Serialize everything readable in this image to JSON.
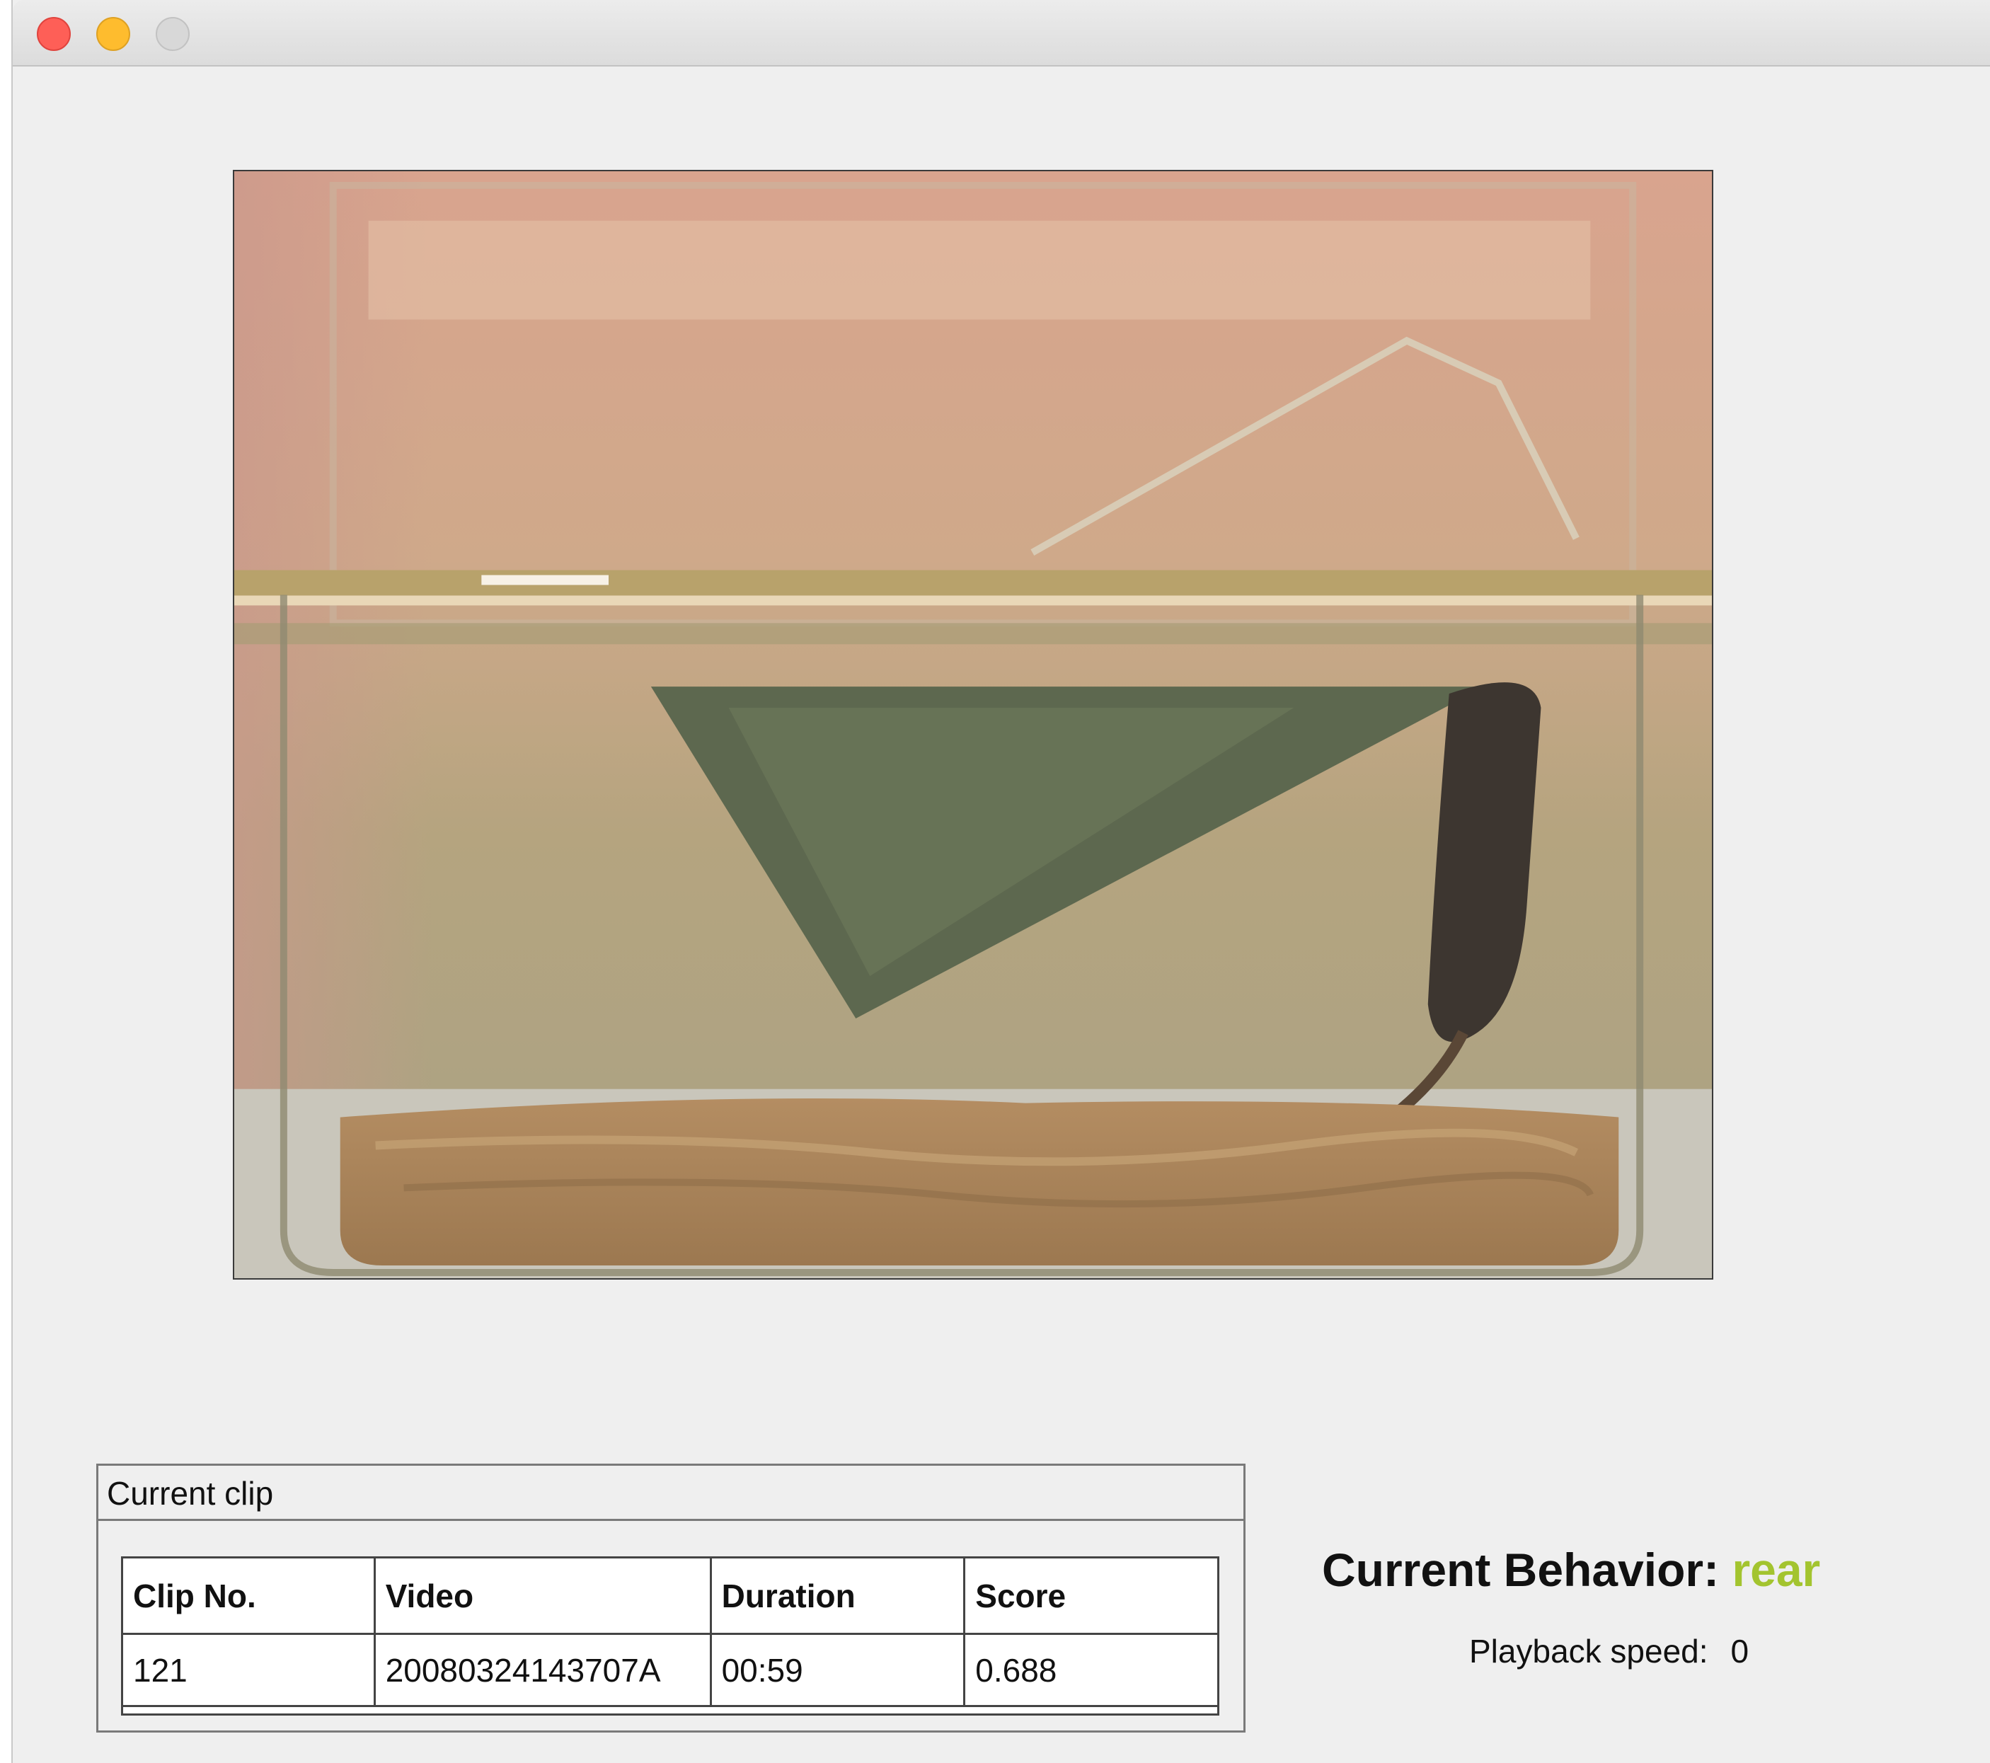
{
  "window": {
    "controls": [
      "close",
      "minimize",
      "zoom"
    ]
  },
  "video_frame": {
    "description_icon": "cage-video-frame"
  },
  "current_clip": {
    "title": "Current clip",
    "columns": [
      "Clip No.",
      "Video",
      "Duration",
      "Score"
    ],
    "rows": [
      [
        "121",
        "20080324143707A",
        "00:59",
        "0.688"
      ]
    ]
  },
  "status": {
    "behavior_label": "Current Behavior:",
    "behavior_value": "rear",
    "behavior_color": "#a3c42f",
    "speed_label": "Playback speed:",
    "speed_value": "0"
  }
}
